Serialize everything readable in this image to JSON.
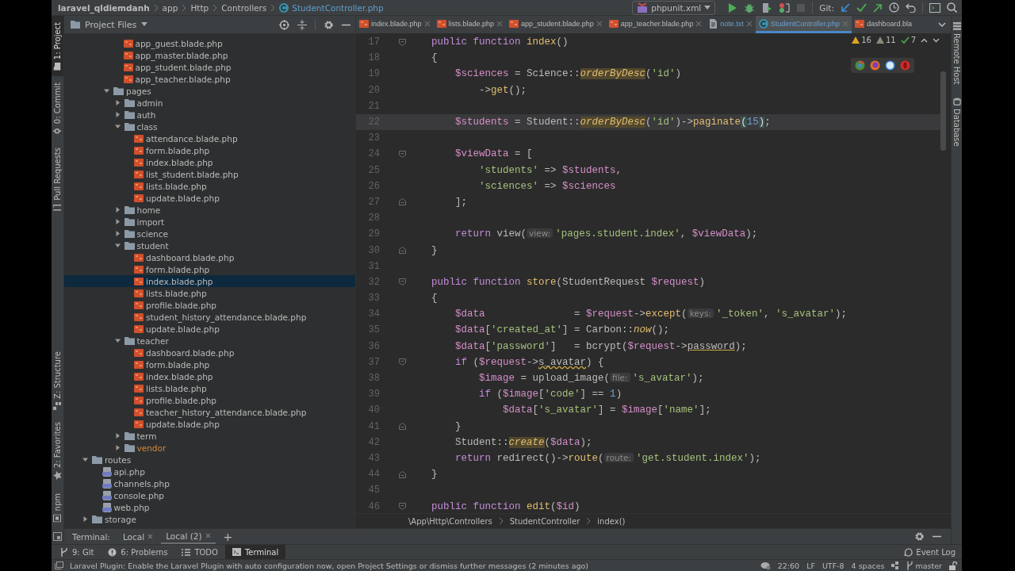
{
  "breadcrumb": [
    {
      "label": "laravel_qldiemdanh",
      "kind": "project"
    },
    {
      "label": "app",
      "kind": "folder"
    },
    {
      "label": "Http",
      "kind": "folder"
    },
    {
      "label": "Controllers",
      "kind": "folder"
    },
    {
      "label": "StudentController.php",
      "kind": "class"
    }
  ],
  "toolbar": {
    "run_config": "phpunit.xml",
    "git_label": "Git:"
  },
  "left_strip": {
    "top": [
      {
        "label": "1: Project",
        "kind": "project",
        "selected": true
      },
      {
        "label": "0: Commit",
        "kind": "commit",
        "selected": false
      },
      {
        "label": "Pull Requests",
        "kind": "pull",
        "selected": false
      }
    ],
    "bottom": [
      {
        "label": "Z: Structure",
        "kind": "structure",
        "selected": false
      },
      {
        "label": "2: Favorites",
        "kind": "favorites",
        "selected": false
      },
      {
        "label": "npm",
        "kind": "npm",
        "selected": false
      }
    ]
  },
  "project_panel": {
    "title": "Project Files",
    "tree": [
      {
        "children": [
          {
            "children": [
              {
                "children": [
                  {
                    "label": "app_guest.blade.php",
                    "kind": "blade",
                    "selected": false
                  },
                  {
                    "label": "app_master.blade.php",
                    "kind": "blade",
                    "selected": false
                  },
                  {
                    "label": "app_student.blade.php",
                    "kind": "blade",
                    "selected": false
                  },
                  {
                    "label": "app_teacher.blade.php",
                    "kind": "blade",
                    "selected": false
                  }
                ]
              },
              {
                "label": "pages",
                "kind": "folder",
                "selected": false,
                "expanded": true,
                "excluded": false,
                "children": [
                  {
                    "label": "admin",
                    "kind": "folder",
                    "selected": false,
                    "expanded": false,
                    "excluded": false
                  },
                  {
                    "label": "auth",
                    "kind": "folder",
                    "selected": false,
                    "expanded": false,
                    "excluded": false
                  },
                  {
                    "label": "class",
                    "kind": "folder",
                    "selected": false,
                    "expanded": true,
                    "excluded": false,
                    "children": [
                      {
                        "label": "attendance.blade.php",
                        "kind": "blade",
                        "selected": false
                      },
                      {
                        "label": "form.blade.php",
                        "kind": "blade",
                        "selected": false
                      },
                      {
                        "label": "index.blade.php",
                        "kind": "blade",
                        "selected": false
                      },
                      {
                        "label": "list_student.blade.php",
                        "kind": "blade",
                        "selected": false
                      },
                      {
                        "label": "lists.blade.php",
                        "kind": "blade",
                        "selected": false
                      },
                      {
                        "label": "update.blade.php",
                        "kind": "blade",
                        "selected": false
                      }
                    ]
                  },
                  {
                    "label": "home",
                    "kind": "folder",
                    "selected": false,
                    "expanded": false,
                    "excluded": false
                  },
                  {
                    "label": "import",
                    "kind": "folder",
                    "selected": false,
                    "expanded": false,
                    "excluded": false
                  },
                  {
                    "label": "science",
                    "kind": "folder",
                    "selected": false,
                    "expanded": false,
                    "excluded": false
                  },
                  {
                    "label": "student",
                    "kind": "folder",
                    "selected": false,
                    "expanded": true,
                    "excluded": false,
                    "children": [
                      {
                        "label": "dashboard.blade.php",
                        "kind": "blade",
                        "selected": false
                      },
                      {
                        "label": "form.blade.php",
                        "kind": "blade",
                        "selected": false
                      },
                      {
                        "label": "index.blade.php",
                        "kind": "blade",
                        "selected": true
                      },
                      {
                        "label": "lists.blade.php",
                        "kind": "blade",
                        "selected": false
                      },
                      {
                        "label": "profile.blade.php",
                        "kind": "blade",
                        "selected": false
                      },
                      {
                        "label": "student_history_attendance.blade.php",
                        "kind": "blade",
                        "selected": false
                      },
                      {
                        "label": "update.blade.php",
                        "kind": "blade",
                        "selected": false
                      }
                    ]
                  },
                  {
                    "label": "teacher",
                    "kind": "folder",
                    "selected": false,
                    "expanded": true,
                    "excluded": false,
                    "children": [
                      {
                        "label": "dashboard.blade.php",
                        "kind": "blade",
                        "selected": false
                      },
                      {
                        "label": "form.blade.php",
                        "kind": "blade",
                        "selected": false
                      },
                      {
                        "label": "index.blade.php",
                        "kind": "blade",
                        "selected": false
                      },
                      {
                        "label": "lists.blade.php",
                        "kind": "blade",
                        "selected": false
                      },
                      {
                        "label": "profile.blade.php",
                        "kind": "blade",
                        "selected": false
                      },
                      {
                        "label": "teacher_history_attendance.blade.php",
                        "kind": "blade",
                        "selected": false
                      },
                      {
                        "label": "update.blade.php",
                        "kind": "blade",
                        "selected": false
                      }
                    ]
                  },
                  {
                    "label": "term",
                    "kind": "folder",
                    "selected": false,
                    "expanded": false,
                    "excluded": false
                  },
                  {
                    "label": "vendor",
                    "kind": "folder",
                    "selected": false,
                    "expanded": false,
                    "excluded": true
                  }
                ]
              }
            ]
          }
        ]
      },
      {
        "label": "routes",
        "kind": "folder",
        "selected": false,
        "expanded": true,
        "excluded": false,
        "children": [
          {
            "label": "api.php",
            "kind": "php",
            "selected": false
          },
          {
            "label": "channels.php",
            "kind": "php",
            "selected": false
          },
          {
            "label": "console.php",
            "kind": "php",
            "selected": false
          },
          {
            "label": "web.php",
            "kind": "php",
            "selected": false
          }
        ]
      },
      {
        "label": "storage",
        "kind": "folder",
        "selected": false,
        "expanded": false,
        "excluded": false
      }
    ]
  },
  "editor": {
    "tabs": [
      {
        "label": "index.blade.php",
        "kind": "blade",
        "selected": false,
        "modified": false
      },
      {
        "label": "lists.blade.php",
        "kind": "blade",
        "selected": false,
        "modified": false
      },
      {
        "label": "app_student.blade.php",
        "kind": "blade",
        "selected": false,
        "modified": false
      },
      {
        "label": "app_teacher.blade.php",
        "kind": "blade",
        "selected": false,
        "modified": false
      },
      {
        "label": "note.txt",
        "kind": "txt",
        "selected": false,
        "modified": true
      },
      {
        "label": "StudentController.php",
        "kind": "class",
        "selected": true,
        "modified": true
      },
      {
        "label": "dashboard.bla",
        "kind": "blade",
        "selected": false,
        "modified": false
      }
    ],
    "inspections": {
      "warnings": "16",
      "weak_warnings": "11",
      "typos": "7"
    },
    "lines": [
      {
        "n": "17",
        "fold_start": true,
        "fold_end": false,
        "current": false,
        "tokens": [
          {
            "kind": "kw",
            "text": "    public function "
          },
          {
            "kind": "fn",
            "text": "index"
          },
          {
            "kind": "p",
            "text": "()"
          }
        ]
      },
      {
        "n": "18",
        "fold_start": false,
        "fold_end": false,
        "current": false,
        "tokens": [
          {
            "kind": "p",
            "text": "    {"
          }
        ]
      },
      {
        "n": "19",
        "fold_start": false,
        "fold_end": false,
        "current": false,
        "tokens": [
          {
            "kind": "var",
            "text": "        $sciences"
          },
          {
            "kind": "p",
            "text": " = Science::"
          },
          {
            "kind": "sth",
            "text": "orderByDesc"
          },
          {
            "kind": "p",
            "text": "("
          },
          {
            "kind": "str",
            "text": "'id'"
          },
          {
            "kind": "p",
            "text": ")"
          }
        ]
      },
      {
        "n": "20",
        "fold_start": false,
        "fold_end": false,
        "current": false,
        "tokens": [
          {
            "kind": "p",
            "text": "            ->"
          },
          {
            "kind": "fn",
            "text": "get"
          },
          {
            "kind": "p",
            "text": "();"
          }
        ]
      },
      {
        "n": "21",
        "fold_start": false,
        "fold_end": false,
        "current": false
      },
      {
        "n": "22",
        "fold_start": false,
        "fold_end": false,
        "current": true,
        "tokens": [
          {
            "kind": "var",
            "text": "        $students"
          },
          {
            "kind": "p",
            "text": " = Student::"
          },
          {
            "kind": "sth",
            "text": "orderByDesc"
          },
          {
            "kind": "p",
            "text": "("
          },
          {
            "kind": "str",
            "text": "'id'"
          },
          {
            "kind": "p",
            "text": ")->"
          },
          {
            "kind": "fn",
            "text": "paginate"
          },
          {
            "kind": "brace",
            "text": "("
          },
          {
            "kind": "num",
            "text": "15"
          },
          {
            "kind": "brace",
            "text": ")"
          },
          {
            "kind": "p",
            "text": ";"
          }
        ]
      },
      {
        "n": "23",
        "fold_start": false,
        "fold_end": false,
        "current": false
      },
      {
        "n": "24",
        "fold_start": true,
        "fold_end": false,
        "current": false,
        "tokens": [
          {
            "kind": "var",
            "text": "        $viewData"
          },
          {
            "kind": "p",
            "text": " = ["
          }
        ]
      },
      {
        "n": "25",
        "fold_start": false,
        "fold_end": false,
        "current": false,
        "tokens": [
          {
            "kind": "str",
            "text": "            'students'"
          },
          {
            "kind": "p",
            "text": " => "
          },
          {
            "kind": "var",
            "text": "$students"
          },
          {
            "kind": "p",
            "text": ","
          }
        ]
      },
      {
        "n": "26",
        "fold_start": false,
        "fold_end": false,
        "current": false,
        "tokens": [
          {
            "kind": "str",
            "text": "            'sciences'"
          },
          {
            "kind": "p",
            "text": " => "
          },
          {
            "kind": "var",
            "text": "$sciences"
          }
        ]
      },
      {
        "n": "27",
        "fold_start": false,
        "fold_end": true,
        "current": false,
        "tokens": [
          {
            "kind": "p",
            "text": "        ];"
          }
        ]
      },
      {
        "n": "28",
        "fold_start": false,
        "fold_end": false,
        "current": false
      },
      {
        "n": "29",
        "fold_start": false,
        "fold_end": false,
        "current": false,
        "tokens": [
          {
            "kind": "kw",
            "text": "        return"
          },
          {
            "kind": "p",
            "text": " view("
          },
          {
            "kind": "hint",
            "text": "view:"
          },
          {
            "kind": "str",
            "text": "'pages.student.index'"
          },
          {
            "kind": "p",
            "text": ", "
          },
          {
            "kind": "var",
            "text": "$viewData"
          },
          {
            "kind": "p",
            "text": ");"
          }
        ]
      },
      {
        "n": "30",
        "fold_start": false,
        "fold_end": true,
        "current": false,
        "tokens": [
          {
            "kind": "p",
            "text": "    }"
          }
        ]
      },
      {
        "n": "31",
        "fold_start": false,
        "fold_end": false,
        "current": false
      },
      {
        "n": "32",
        "fold_start": true,
        "fold_end": false,
        "current": false,
        "tokens": [
          {
            "kind": "kw",
            "text": "    public function "
          },
          {
            "kind": "fn",
            "text": "store"
          },
          {
            "kind": "p",
            "text": "(StudentRequest "
          },
          {
            "kind": "var",
            "text": "$request"
          },
          {
            "kind": "p",
            "text": ")"
          }
        ]
      },
      {
        "n": "33",
        "fold_start": false,
        "fold_end": false,
        "current": false,
        "tokens": [
          {
            "kind": "p",
            "text": "    {"
          }
        ]
      },
      {
        "n": "34",
        "fold_start": false,
        "fold_end": false,
        "current": false,
        "tokens": [
          {
            "kind": "var",
            "text": "        $data"
          },
          {
            "kind": "p",
            "text": "               = "
          },
          {
            "kind": "var",
            "text": "$request"
          },
          {
            "kind": "p",
            "text": "->"
          },
          {
            "kind": "fn",
            "text": "except"
          },
          {
            "kind": "p",
            "text": "("
          },
          {
            "kind": "hint",
            "text": "keys:"
          },
          {
            "kind": "str",
            "text": "'_token'"
          },
          {
            "kind": "p",
            "text": ", "
          },
          {
            "kind": "str",
            "text": "'s_avatar'"
          },
          {
            "kind": "p",
            "text": ");"
          }
        ]
      },
      {
        "n": "35",
        "fold_start": false,
        "fold_end": false,
        "current": false,
        "tokens": [
          {
            "kind": "var",
            "text": "        $data"
          },
          {
            "kind": "p",
            "text": "["
          },
          {
            "kind": "str",
            "text": "'created_at'"
          },
          {
            "kind": "p",
            "text": "] = Carbon::"
          },
          {
            "kind": "st",
            "text": "now"
          },
          {
            "kind": "p",
            "text": "();"
          }
        ]
      },
      {
        "n": "36",
        "fold_start": false,
        "fold_end": false,
        "current": false,
        "tokens": [
          {
            "kind": "var",
            "text": "        $data"
          },
          {
            "kind": "p",
            "text": "["
          },
          {
            "kind": "str",
            "text": "'password'"
          },
          {
            "kind": "p",
            "text": "]   = bcrypt("
          },
          {
            "kind": "var",
            "text": "$request"
          },
          {
            "kind": "p",
            "text": "->"
          },
          {
            "kind": "warn",
            "text": "password"
          },
          {
            "kind": "p",
            "text": ");"
          }
        ]
      },
      {
        "n": "37",
        "fold_start": true,
        "fold_end": false,
        "current": false,
        "tokens": [
          {
            "kind": "kw",
            "text": "        if"
          },
          {
            "kind": "p",
            "text": " ("
          },
          {
            "kind": "var",
            "text": "$request"
          },
          {
            "kind": "p",
            "text": "->"
          },
          {
            "kind": "wavy",
            "text": "s_avatar"
          },
          {
            "kind": "p",
            "text": ") {"
          }
        ]
      },
      {
        "n": "38",
        "fold_start": false,
        "fold_end": false,
        "current": false,
        "tokens": [
          {
            "kind": "var",
            "text": "            $image"
          },
          {
            "kind": "p",
            "text": " = upload_image("
          },
          {
            "kind": "hint",
            "text": "file:"
          },
          {
            "kind": "str",
            "text": "'s_avatar'"
          },
          {
            "kind": "p",
            "text": ");"
          }
        ]
      },
      {
        "n": "39",
        "fold_start": false,
        "fold_end": false,
        "current": false,
        "tokens": [
          {
            "kind": "kw",
            "text": "            if"
          },
          {
            "kind": "p",
            "text": " ("
          },
          {
            "kind": "var",
            "text": "$image"
          },
          {
            "kind": "p",
            "text": "["
          },
          {
            "kind": "str",
            "text": "'code'"
          },
          {
            "kind": "p",
            "text": "] == "
          },
          {
            "kind": "num",
            "text": "1"
          },
          {
            "kind": "p",
            "text": ")"
          }
        ]
      },
      {
        "n": "40",
        "fold_start": false,
        "fold_end": false,
        "current": false,
        "tokens": [
          {
            "kind": "var",
            "text": "                $data"
          },
          {
            "kind": "p",
            "text": "["
          },
          {
            "kind": "str",
            "text": "'s_avatar'"
          },
          {
            "kind": "p",
            "text": "] = "
          },
          {
            "kind": "var",
            "text": "$image"
          },
          {
            "kind": "p",
            "text": "["
          },
          {
            "kind": "str",
            "text": "'name'"
          },
          {
            "kind": "p",
            "text": "];"
          }
        ]
      },
      {
        "n": "41",
        "fold_start": false,
        "fold_end": true,
        "current": false,
        "tokens": [
          {
            "kind": "p",
            "text": "        }"
          }
        ]
      },
      {
        "n": "42",
        "fold_start": false,
        "fold_end": false,
        "current": false,
        "tokens": [
          {
            "kind": "p",
            "text": "        Student::"
          },
          {
            "kind": "sth",
            "text": "create"
          },
          {
            "kind": "p",
            "text": "("
          },
          {
            "kind": "var",
            "text": "$data"
          },
          {
            "kind": "p",
            "text": ");"
          }
        ]
      },
      {
        "n": "43",
        "fold_start": false,
        "fold_end": false,
        "current": false,
        "tokens": [
          {
            "kind": "kw",
            "text": "        return"
          },
          {
            "kind": "p",
            "text": " redirect()->"
          },
          {
            "kind": "fn",
            "text": "route"
          },
          {
            "kind": "p",
            "text": "("
          },
          {
            "kind": "hint",
            "text": "route:"
          },
          {
            "kind": "str",
            "text": "'get.student.index'"
          },
          {
            "kind": "p",
            "text": ");"
          }
        ]
      },
      {
        "n": "44",
        "fold_start": false,
        "fold_end": true,
        "current": false,
        "tokens": [
          {
            "kind": "p",
            "text": "    }"
          }
        ]
      },
      {
        "n": "45",
        "fold_start": false,
        "fold_end": false,
        "current": false
      },
      {
        "n": "46",
        "fold_start": true,
        "fold_end": false,
        "current": false,
        "tokens": [
          {
            "kind": "kw",
            "text": "    public function "
          },
          {
            "kind": "fn",
            "text": "edit"
          },
          {
            "kind": "p",
            "text": "("
          },
          {
            "kind": "var",
            "text": "$id"
          },
          {
            "kind": "p",
            "text": ")"
          }
        ]
      }
    ],
    "breadcrumb": [
      "\\App\\Http\\Controllers",
      "StudentController",
      "index()"
    ]
  },
  "right_strip": [
    {
      "label": "Remote Host",
      "kind": "remote"
    },
    {
      "label": "Database",
      "kind": "database"
    }
  ],
  "terminal": {
    "title": "Terminal:",
    "tabs": [
      {
        "label": "Local",
        "selected": false
      },
      {
        "label": "Local (2)",
        "selected": true
      }
    ],
    "add": "+"
  },
  "tool_tabs": [
    {
      "label": "9: Git",
      "kind": "git",
      "selected": false
    },
    {
      "label": "6: Problems",
      "kind": "problems",
      "selected": false
    },
    {
      "label": "TODO",
      "kind": "todo",
      "selected": false
    },
    {
      "label": "Terminal",
      "kind": "terminal",
      "selected": true
    }
  ],
  "event_log": "Event Log",
  "status_bar": {
    "message": "Laravel Plugin: Enable the Laravel Plugin with auto configuration now, open Project Settings or dismiss further messages (2 minutes ago)",
    "position": "22:60",
    "line_separator": "LF",
    "encoding": "UTF-8",
    "indent": "4 spaces",
    "branch": "master"
  }
}
